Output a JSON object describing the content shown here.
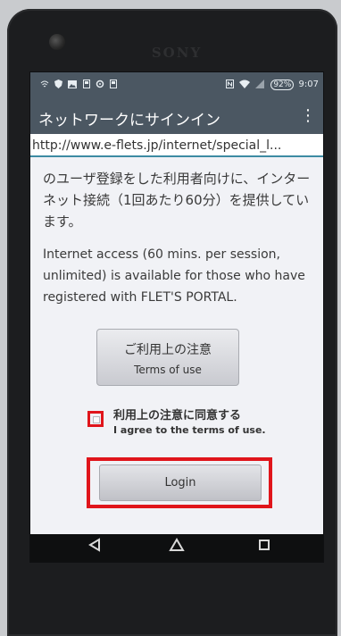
{
  "device": {
    "brand": "SONY"
  },
  "statusbar": {
    "icons": [
      "wifi-icon",
      "shield-icon",
      "photo-icon",
      "notification-icon",
      "settings-icon",
      "notification-icon"
    ],
    "battery": "92%",
    "time": "9:07"
  },
  "appbar": {
    "title": "ネットワークにサインイン",
    "menu_icon": "overflow-menu-icon"
  },
  "url": {
    "text": "http://www.e-flets.jp/internet/special_l..."
  },
  "content": {
    "para_ja": "のユーザ登録をした利用者向けに、インターネット接続（1回あたり60分）を提供しています。",
    "para_en": "Internet access (60 mins. per session, unlimited) is available for those who have registered with FLET'S PORTAL.",
    "terms_button": {
      "label_ja": "ご利用上の注意",
      "label_en": "Terms of use"
    },
    "agree": {
      "label_ja": "利用上の注意に同意する",
      "label_en": "I agree to the terms of use.",
      "checked": false
    },
    "login_button": {
      "label": "Login"
    }
  },
  "highlight_color": "#e0151b",
  "navbar": {
    "icons": [
      "back-icon",
      "home-icon",
      "recents-icon"
    ]
  }
}
